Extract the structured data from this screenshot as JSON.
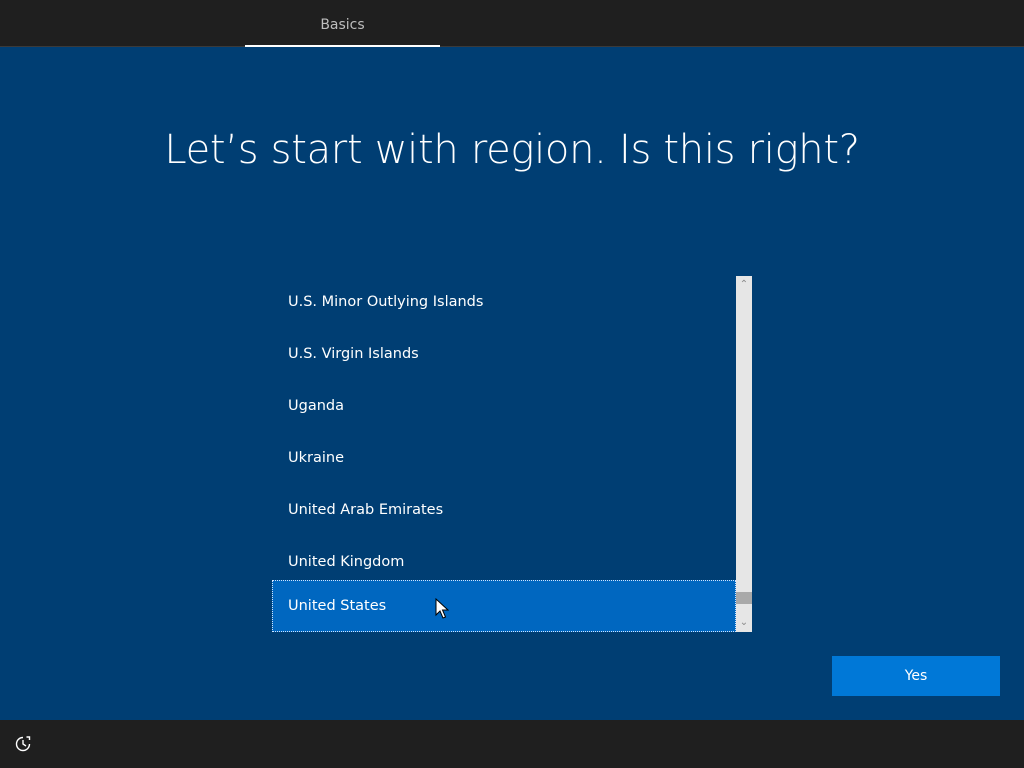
{
  "header": {
    "tabs": [
      {
        "label": "Basics",
        "active": true
      }
    ]
  },
  "main": {
    "title": "Let’s start with region. Is this right?",
    "region_list": {
      "items": [
        "U.S. Minor Outlying Islands",
        "U.S. Virgin Islands",
        "Uganda",
        "Ukraine",
        "United Arab Emirates",
        "United Kingdom",
        "United States"
      ],
      "selected": "United States"
    },
    "yes_button_label": "Yes"
  },
  "footer": {
    "accessibility_icon": "ease-of-access-icon"
  },
  "colors": {
    "background": "#003e73",
    "bars": "#1f1f1f",
    "selected_item": "#0067c0",
    "button": "#0078d7"
  }
}
